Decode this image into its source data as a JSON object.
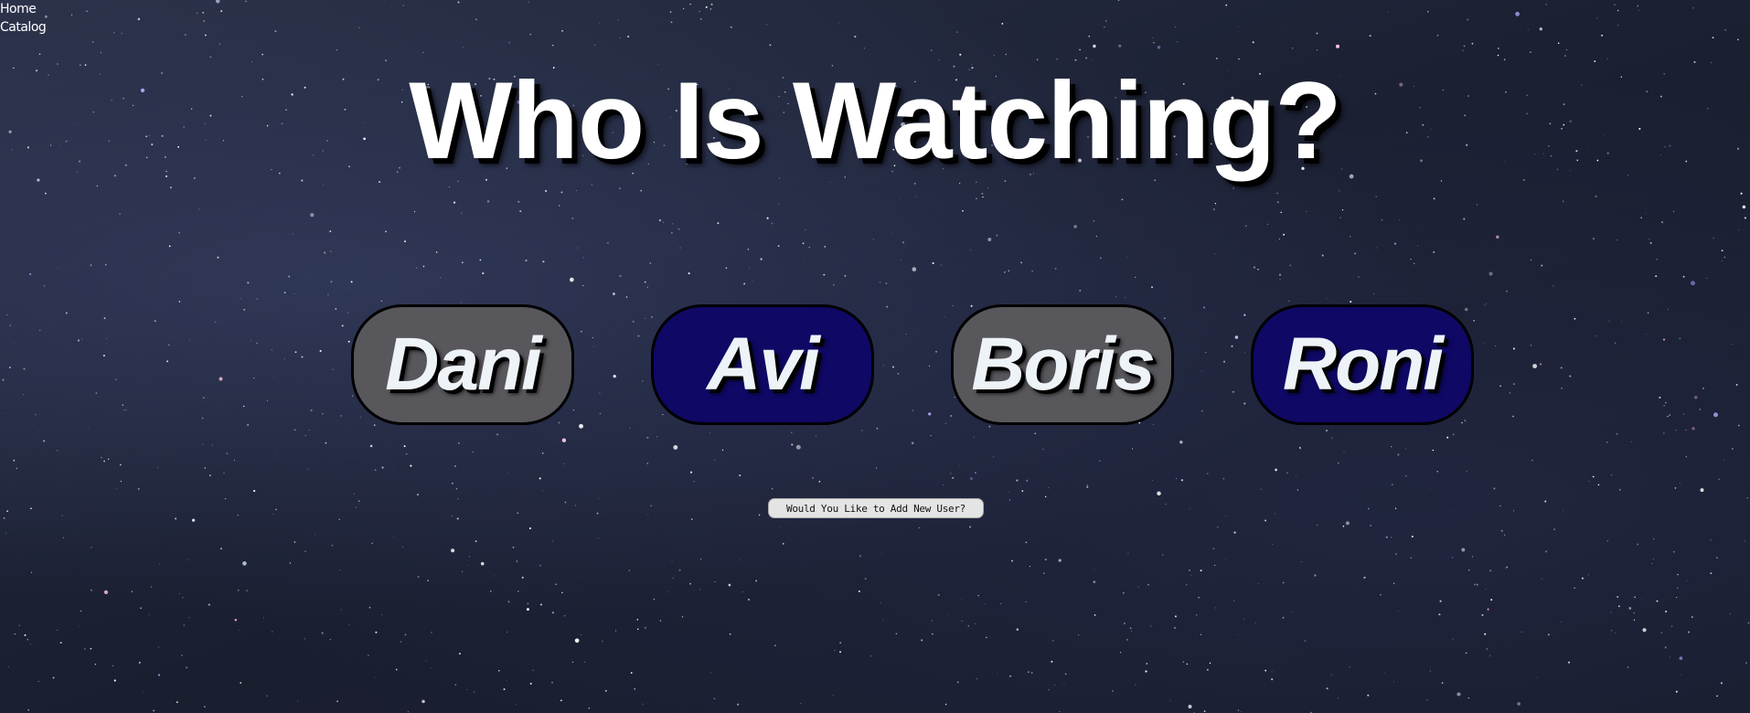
{
  "nav": {
    "items": [
      {
        "label": "Home"
      },
      {
        "label": "Catalog"
      }
    ]
  },
  "heading": {
    "title": "Who Is Watching?"
  },
  "profiles": [
    {
      "name": "Dani",
      "color": "#58575c"
    },
    {
      "name": "Avi",
      "color": "#0f0865"
    },
    {
      "name": "Boris",
      "color": "#58575c"
    },
    {
      "name": "Roni",
      "color": "#0f0865"
    }
  ],
  "actions": {
    "add_user_label": "Would You Like to Add New User?"
  },
  "theme": {
    "background": "starry-night-sky",
    "title_color": "#ffffff",
    "profile_text_color": "#eef3f8"
  }
}
